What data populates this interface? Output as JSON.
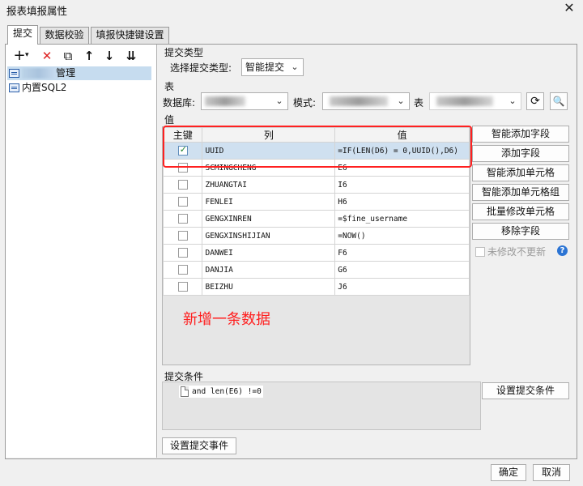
{
  "window": {
    "title": "报表填报属性",
    "close_glyph": "✕"
  },
  "tabs": [
    "提交",
    "数据校验",
    "填报快捷键设置"
  ],
  "toolbar": {
    "add_glyph": "+",
    "add_dropdown_glyph": "▾",
    "delete_glyph": "✕",
    "copy_glyph": "⧉",
    "up_glyph": "↑",
    "down_glyph": "↓",
    "sort_glyph": "⇊"
  },
  "tree": {
    "items": [
      {
        "prefix": "",
        "label": "管理"
      },
      {
        "prefix": "",
        "label": "内置SQL2"
      }
    ]
  },
  "submit_type": {
    "section_label": "提交类型",
    "select_label": "选择提交类型:",
    "value": "智能提交"
  },
  "table_section": {
    "section_label": "表",
    "database_label": "数据库:",
    "mode_label": "模式:",
    "table_label": "表"
  },
  "values_section": {
    "section_label": "值",
    "columns": [
      "主键",
      "列",
      "值"
    ],
    "rows": [
      {
        "key": true,
        "column": "UUID",
        "value": "=IF(LEN(D6) = 0,UUID(),D6)"
      },
      {
        "key": false,
        "column": "SCMINGCHENG",
        "value": "E6"
      },
      {
        "key": false,
        "column": "ZHUANGTAI",
        "value": "I6"
      },
      {
        "key": false,
        "column": "FENLEI",
        "value": "H6"
      },
      {
        "key": false,
        "column": "GENGXINREN",
        "value": "=$fine_username"
      },
      {
        "key": false,
        "column": "GENGXINSHIJIAN",
        "value": "=NOW()"
      },
      {
        "key": false,
        "column": "DANWEI",
        "value": "F6"
      },
      {
        "key": false,
        "column": "DANJIA",
        "value": "G6"
      },
      {
        "key": false,
        "column": "BEIZHU",
        "value": "J6"
      }
    ],
    "annotation": "新增一条数据"
  },
  "side_buttons": [
    "智能添加字段",
    "添加字段",
    "智能添加单元格",
    "智能添加单元格组",
    "批量修改单元格",
    "移除字段"
  ],
  "no_update_checkbox": {
    "label": "未修改不更新",
    "checked": false
  },
  "submit_condition": {
    "section_label": "提交条件",
    "expression": "and len(E6) !=0",
    "set_button": "设置提交条件"
  },
  "set_event_button": "设置提交事件",
  "footer": {
    "ok": "确定",
    "cancel": "取消"
  },
  "colors": {
    "accent_red": "#ff2020",
    "selection": "#c6dcef",
    "help_blue": "#2b74d4"
  }
}
